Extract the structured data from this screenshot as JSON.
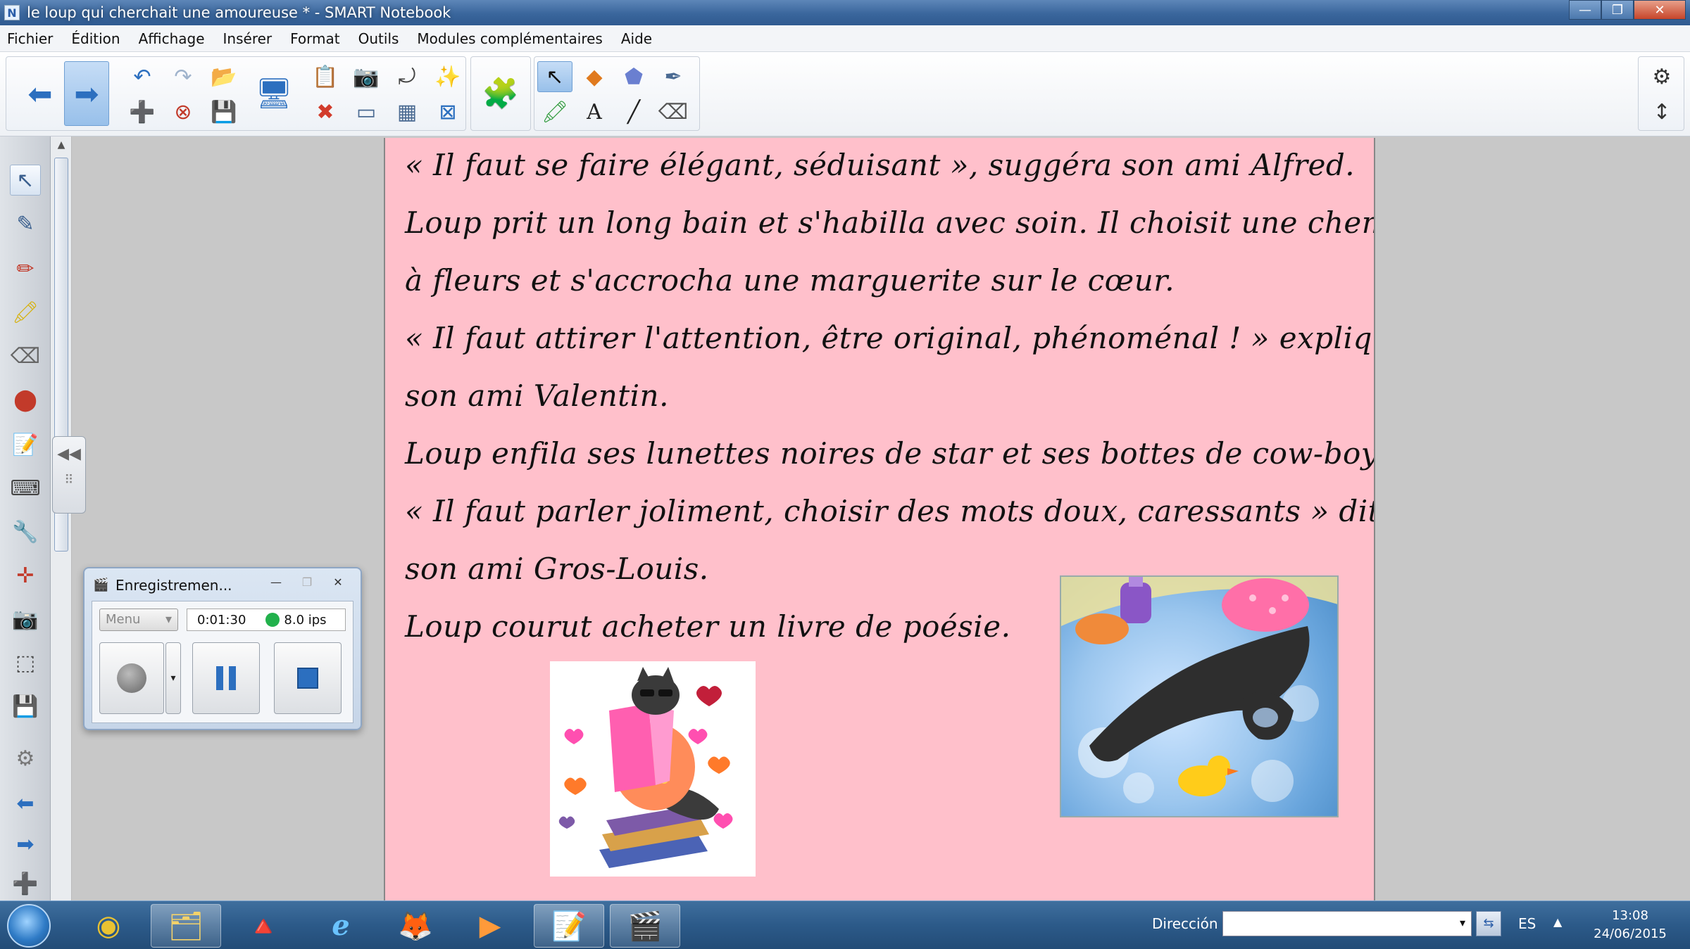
{
  "window": {
    "title": "le loup qui cherchait une amoureuse * - SMART Notebook",
    "app_icon": "N",
    "min_glyph": "—",
    "max_glyph": "❐",
    "close_glyph": "✕"
  },
  "menu": [
    "Fichier",
    "Édition",
    "Affichage",
    "Insérer",
    "Format",
    "Outils",
    "Modules complémentaires",
    "Aide"
  ],
  "toolbar": {
    "back_icon": "arrow-left-icon",
    "forward_icon": "arrow-right-icon",
    "glyphs": {
      "back": "⬅",
      "forward": "➡",
      "undo": "↶",
      "redo": "↷",
      "open": "📂",
      "add_page": "➕",
      "delete_page": "⊗",
      "save": "💾",
      "screen": "🖥",
      "paste": "📋",
      "screenshot": "📷",
      "capture": "⤾",
      "magic": "✨",
      "delete": "✖",
      "screen_shade": "▭",
      "table": "▦",
      "full_screen": "⊠",
      "addons": "🧩",
      "select": "↖",
      "shapes": "◆",
      "fill": "⬟",
      "magic_pen": "✒",
      "pens": "🖍",
      "text": "A",
      "line": "╱",
      "eraser": "⌫",
      "settings": "⚙",
      "move_toolbar": "↕"
    }
  },
  "sidebar": {
    "glyphs": [
      "↖",
      "✎",
      "✏",
      "🖍",
      "⌫",
      "⬤",
      "📝",
      "⌨",
      "🔧",
      "✛",
      "📷",
      "⬚",
      "💾",
      "⚙",
      "⬅",
      "➡",
      "➕"
    ],
    "scroll_up": "▲",
    "collapse": "◀◀"
  },
  "story": {
    "lines": [
      "« Il faut se faire élégant, séduisant », suggéra son ami Alfred.",
      "Loup prit un long bain et s'habilla avec soin. Il choisit une chemise",
      "à fleurs et s'accrocha une marguerite sur le cœur.",
      "« Il faut attirer l'attention, être original, phénoménal ! » expliqua",
      "son ami Valentin.",
      "Loup enfila ses lunettes noires de star et ses bottes de cow-boy.",
      "« Il faut parler joliment, choisir des mots doux, caressants » dit",
      "son ami Gros-Louis.",
      "Loup courut acheter un livre de poésie."
    ]
  },
  "recorder": {
    "title": "Enregistremen...",
    "menu_label": "Menu",
    "menu_arrow": "▾",
    "time": "0:01:30",
    "fps": "8.0 ips",
    "wctrl": [
      "—",
      "❐",
      "✕"
    ]
  },
  "taskbar": {
    "address_label": "Dirección",
    "address_value": "",
    "dropdown": "▾",
    "go": "⇆",
    "lang": "ES",
    "up": "▲",
    "time": "13:08",
    "date": "24/06/2015",
    "apps": [
      "◉",
      "🗂",
      "🔺",
      "ℯ",
      "🦊",
      "▶",
      "📝",
      "🎬"
    ]
  },
  "colors": {
    "page_bg": "#ffc0cb",
    "accent": "#2c6fbf",
    "record_dot": "#22b14c"
  }
}
